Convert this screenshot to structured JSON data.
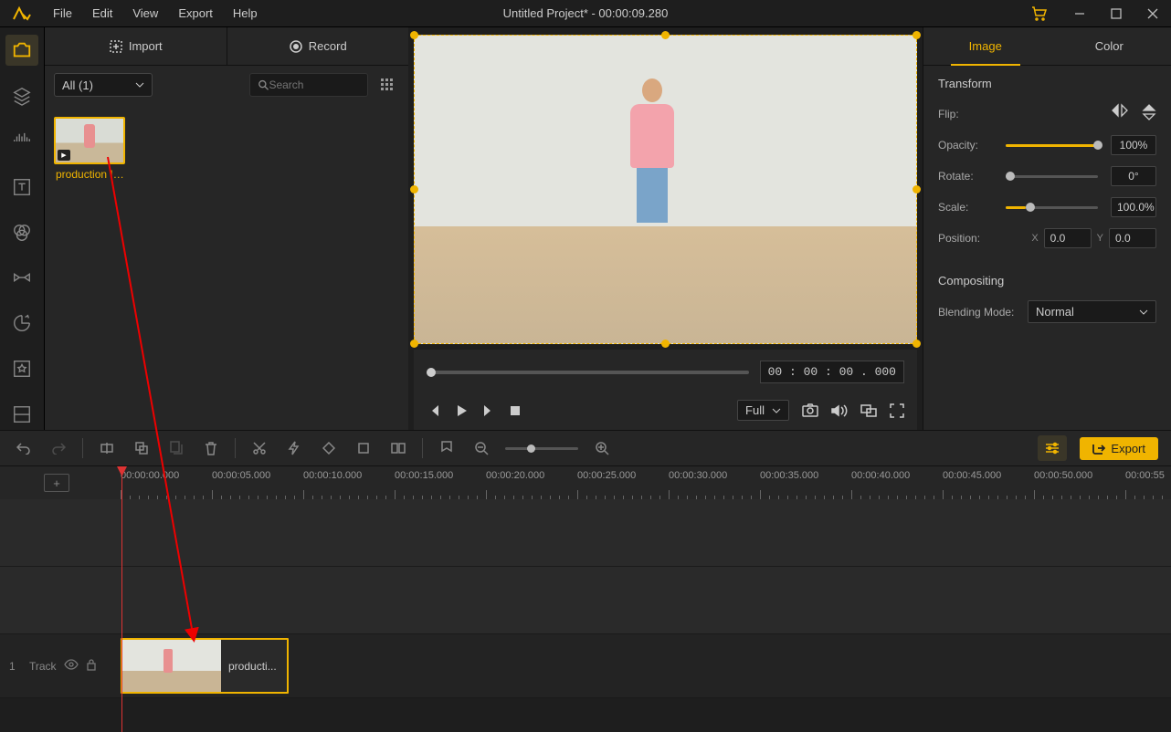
{
  "title": "Untitled Project* - 00:00:09.280",
  "menus": [
    "File",
    "Edit",
    "View",
    "Export",
    "Help"
  ],
  "top_buttons": {
    "import": "Import",
    "record": "Record"
  },
  "media_filter": "All (1)",
  "search_placeholder": "Search",
  "media_item_label": "production I…",
  "preview_time": "00 : 00 : 00 . 000",
  "aspect_label": "Full",
  "tabs": {
    "image": "Image",
    "color": "Color"
  },
  "section_transform": "Transform",
  "section_compositing": "Compositing",
  "props": {
    "flip": "Flip:",
    "opacity": "Opacity:",
    "opacity_val": "100%",
    "rotate": "Rotate:",
    "rotate_val": "0°",
    "scale": "Scale:",
    "scale_val": "100.0%",
    "position": "Position:",
    "pos_x": "0.0",
    "pos_y": "0.0",
    "blending": "Blending Mode:",
    "blend_val": "Normal"
  },
  "export_btn": "Export",
  "ruler_labels": [
    "00:00:00.000",
    "00:00:05.000",
    "00:00:10.000",
    "00:00:15.000",
    "00:00:20.000",
    "00:00:25.000",
    "00:00:30.000",
    "00:00:35.000",
    "00:00:40.000",
    "00:00:45.000",
    "00:00:50.000",
    "00:00:55"
  ],
  "track_num": "1",
  "track_label": "Track",
  "clip_label": "producti..."
}
